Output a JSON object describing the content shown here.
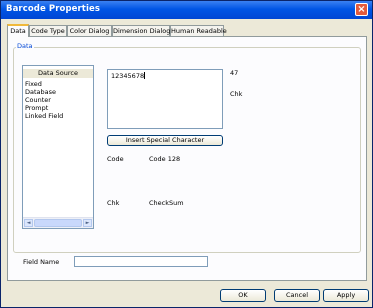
{
  "window": {
    "title": "Barcode Properties",
    "close_glyph": "×"
  },
  "tabs": [
    {
      "label": "Data",
      "active": true
    },
    {
      "label": "Code Type",
      "active": false
    },
    {
      "label": "Color Dialog",
      "active": false
    },
    {
      "label": "Dimension Dialog",
      "active": false
    },
    {
      "label": "Human Readable",
      "active": false
    }
  ],
  "data_group": {
    "label": "Data"
  },
  "data_source": {
    "header": "Data Source",
    "items": [
      "Fixed",
      "Database",
      "Counter",
      "Prompt",
      "Linked Field"
    ],
    "scroll_left": "◄",
    "scroll_right": "►"
  },
  "barcode_data": {
    "value": "12345678"
  },
  "length_value": "47",
  "chk_top": "Chk",
  "insert_special_button": "Insert Special Character",
  "code": {
    "label": "Code",
    "value": "Code 128"
  },
  "chk": {
    "label": "Chk",
    "value": "CheckSum"
  },
  "field_name": {
    "label": "Field Name",
    "value": ""
  },
  "footer": {
    "ok": "OK",
    "cancel": "Cancel",
    "apply": "Apply"
  },
  "colors": {
    "title_bar": "#0055e5",
    "group_label": "#0046d5",
    "tab_highlight": "#f0b93b"
  }
}
